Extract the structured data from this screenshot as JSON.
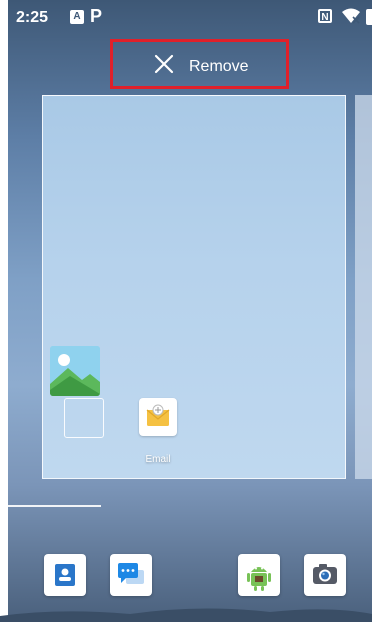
{
  "status_bar": {
    "time": "2:25",
    "notification_a_label": "A",
    "notification_p_label": "P",
    "nfc_label": "N"
  },
  "remove_zone": {
    "label": "Remove",
    "highlight_color": "#e0202a"
  },
  "workspace": {
    "apps": [
      {
        "name": "gallery",
        "label": ""
      },
      {
        "name": "email",
        "label": "Email"
      }
    ]
  },
  "dock": {
    "apps": [
      "contacts",
      "messages",
      "android-app",
      "camera"
    ]
  },
  "colors": {
    "email_envelope": "#f5c142",
    "contacts_blue": "#2a76c9",
    "messages_blue": "#1e88e5",
    "android_green": "#78c257"
  }
}
